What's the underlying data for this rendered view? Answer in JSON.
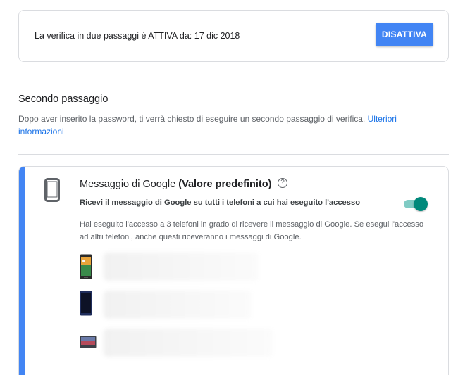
{
  "status": {
    "text": "La verifica in due passaggi è ATTIVA da: 17 dic 2018",
    "disable_label": "DISATTIVA"
  },
  "second_step": {
    "title": "Secondo passaggio",
    "description": "Dopo aver inserito la password, ti verrà chiesto di eseguire un secondo passaggio di verifica.",
    "more_info_link": "Ulteriori informazioni"
  },
  "google_prompt": {
    "title": "Messaggio di Google",
    "default_tag": "(Valore predefinito)",
    "help_glyph": "?",
    "toggle_label": "Ricevi il messaggio di Google su tutti i telefoni a cui hai eseguito l'accesso",
    "toggle_on": true,
    "devices_note": "Hai eseguito l'accesso a 3 telefoni in grado di ricevere il messaggio di Google. Se esegui l'accesso ad altri telefoni, anche questi riceveranno i messaggi di Google."
  },
  "colors": {
    "accent": "#4285f4",
    "toggle_on": "#00897b",
    "link": "#1a73e8"
  },
  "icons": [
    "phone-icon",
    "help-icon",
    "android-phone-thumbnail",
    "dark-phone-thumbnail",
    "tablet-thumbnail"
  ]
}
